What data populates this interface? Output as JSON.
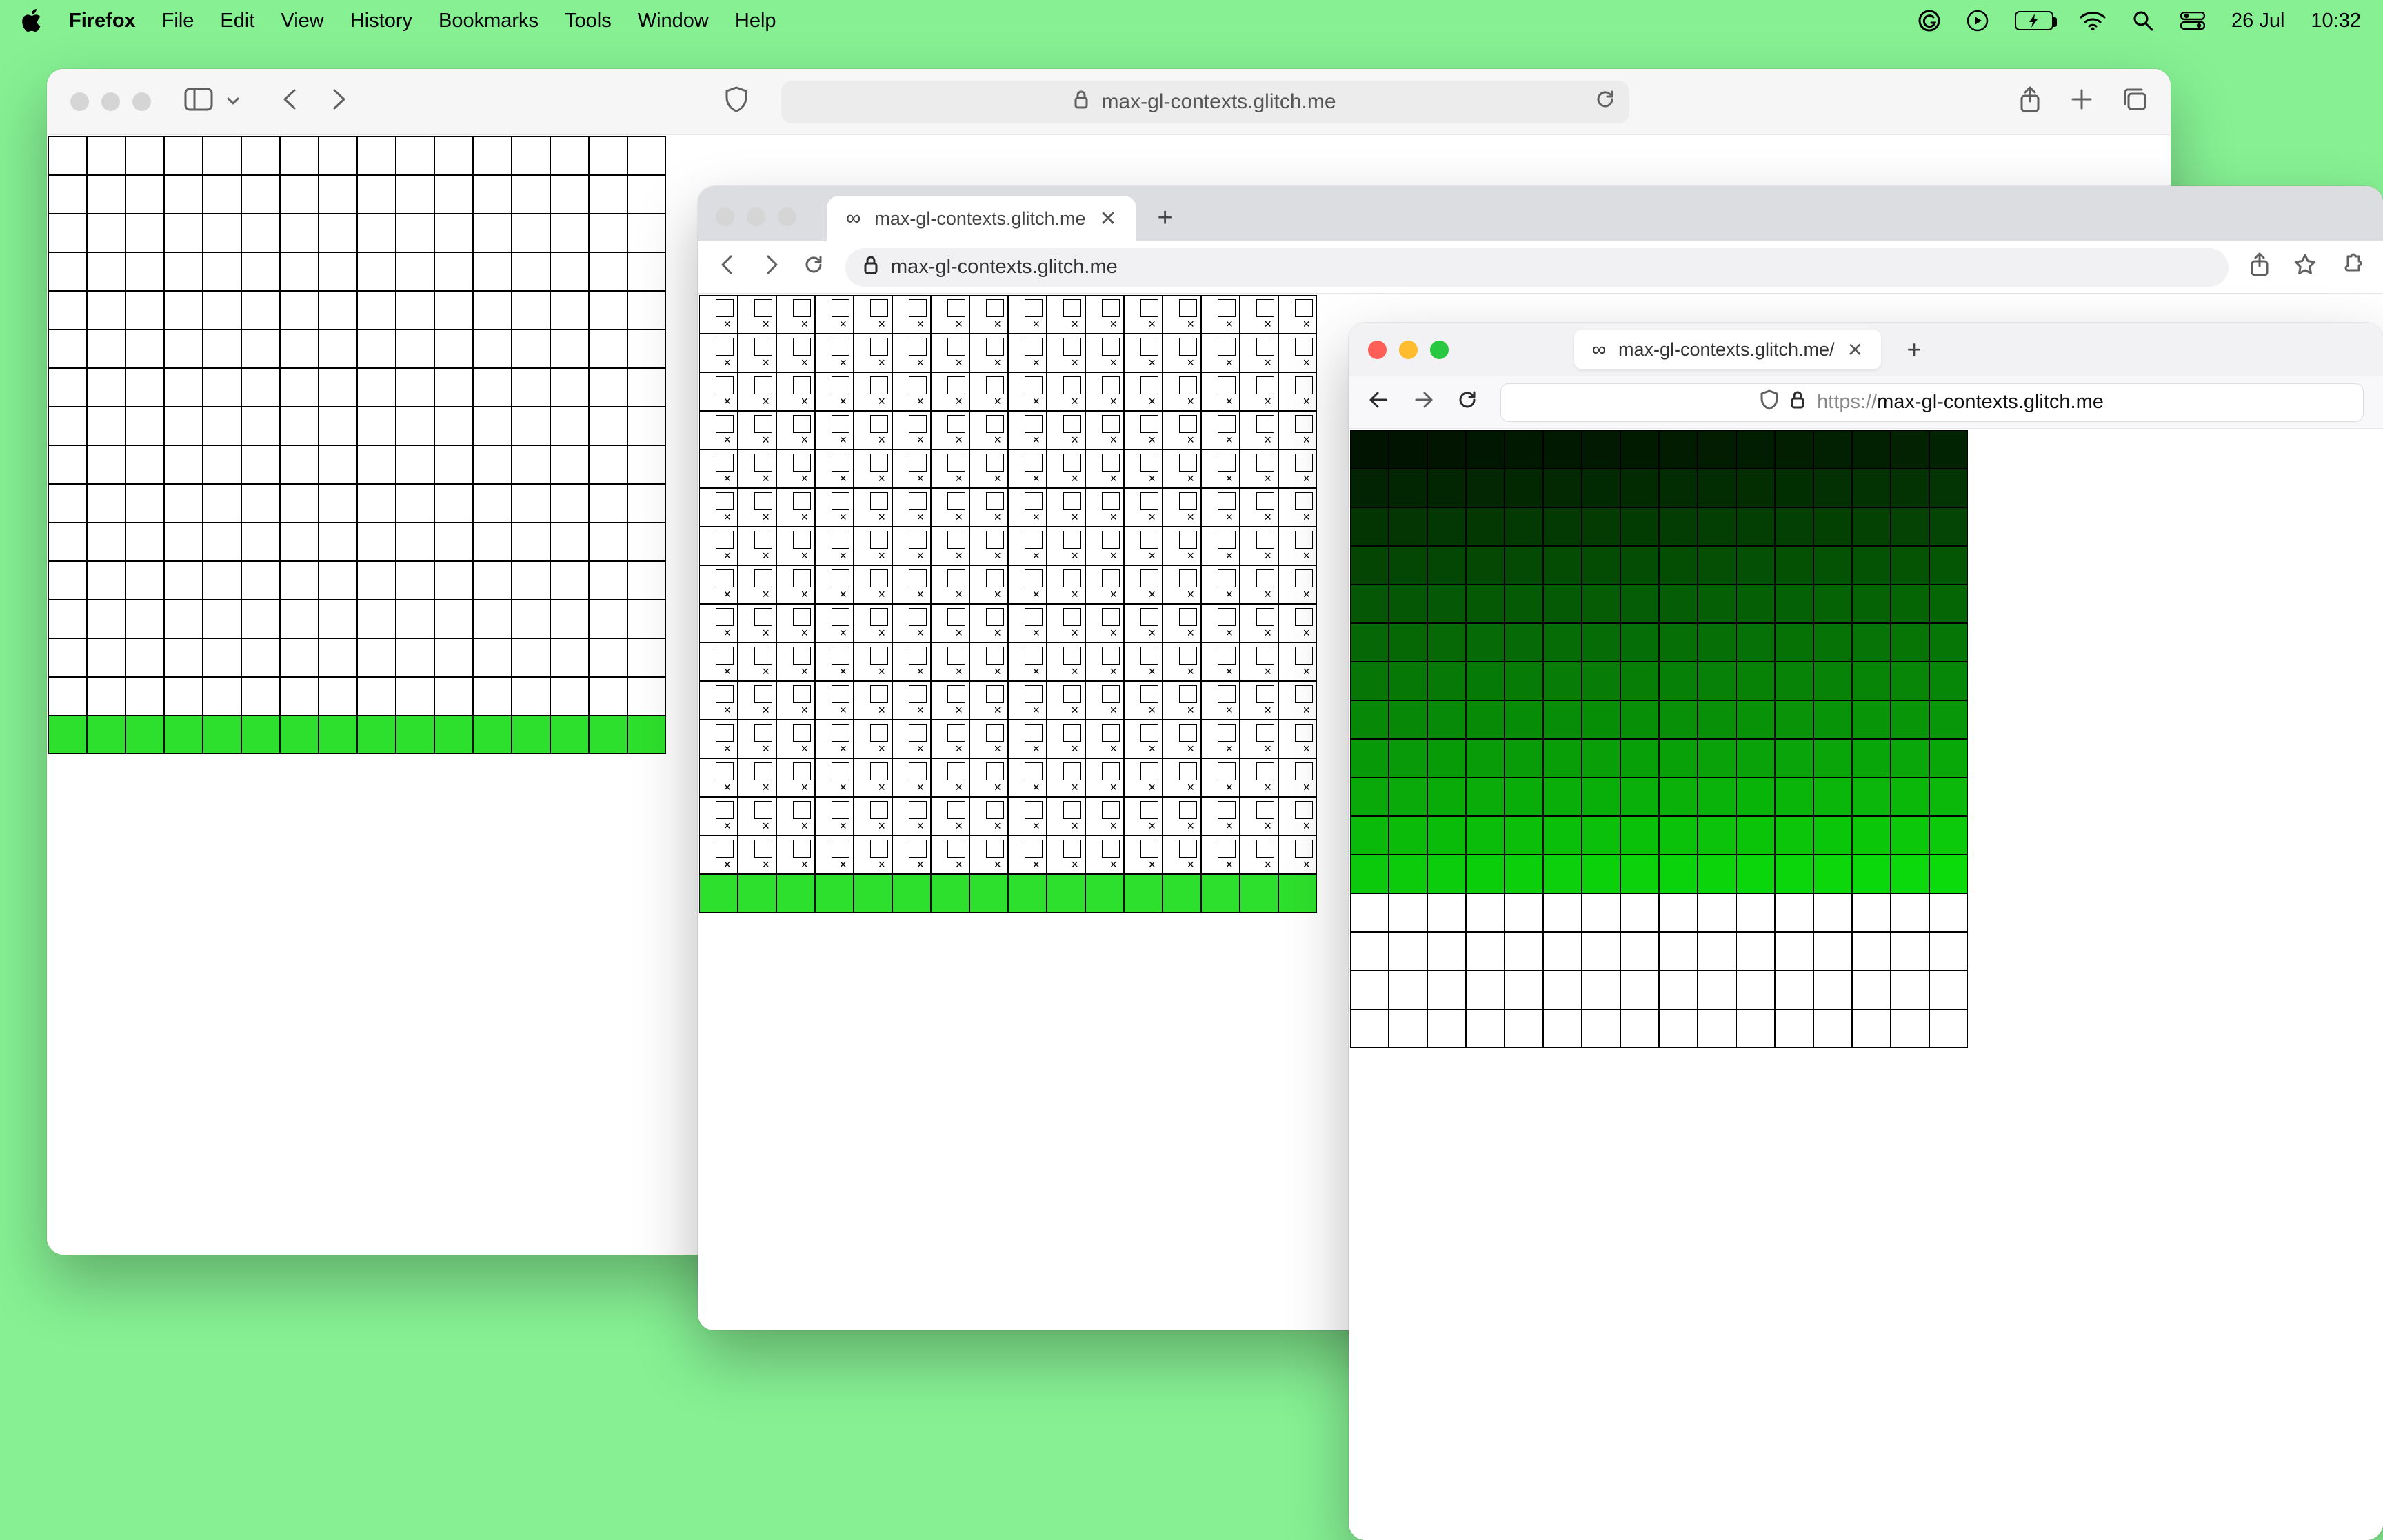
{
  "menubar": {
    "app_name": "Firefox",
    "items": [
      "File",
      "Edit",
      "View",
      "History",
      "Bookmarks",
      "Tools",
      "Window",
      "Help"
    ],
    "date": "26 Jul",
    "time": "10:32"
  },
  "safari": {
    "url_display": "max-gl-contexts.glitch.me",
    "grid": {
      "cols": 16,
      "rows": 16,
      "green_rows": [
        15
      ]
    }
  },
  "chrome": {
    "tab_title": "max-gl-contexts.glitch.me",
    "url_display": "max-gl-contexts.glitch.me",
    "grid": {
      "cols": 16,
      "rows": 16,
      "broken_rows_end": 15,
      "green_rows": [
        15
      ]
    }
  },
  "firefox": {
    "tab_title": "max-gl-contexts.glitch.me/",
    "url_proto": "https://",
    "url_host": "max-gl-contexts.glitch.me",
    "grid": {
      "cols": 16,
      "rows": 16,
      "shaded_until_index": 191,
      "empty_from_index": 192
    }
  }
}
